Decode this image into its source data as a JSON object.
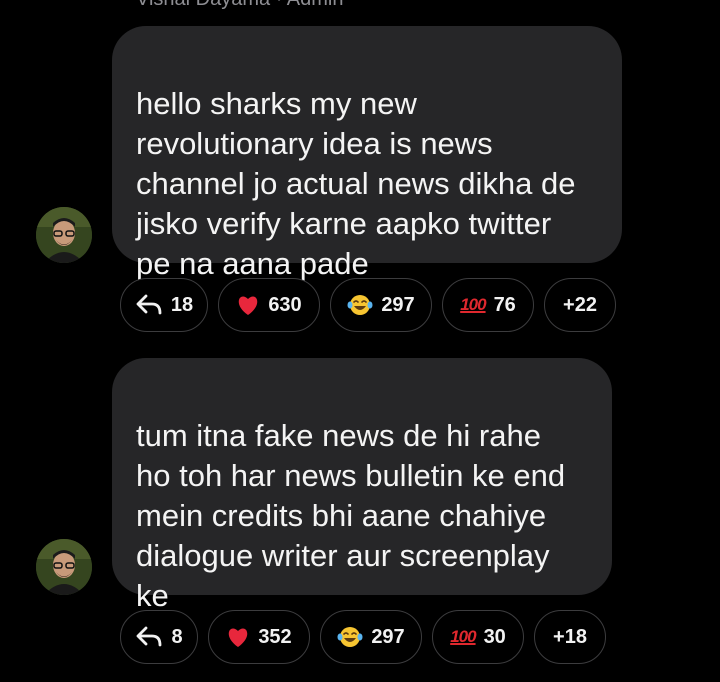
{
  "header": {
    "sender": "Vishal Dayama · Admin"
  },
  "messages": [
    {
      "text": "hello sharks my new\nrevolutionary idea is news\nchannel jo actual news dikha de\njisko verify karne aapko twitter\npe na aana pade",
      "reactions": {
        "reply": "18",
        "heart": "630",
        "laugh": "297",
        "hundred": "76",
        "more": "+22"
      }
    },
    {
      "text": "tum itna fake news de hi rahe\nho toh har news bulletin ke end\nmein credits bhi aane chahiye\ndialogue writer aur screenplay\nke",
      "reactions": {
        "reply": "8",
        "heart": "352",
        "laugh": "297",
        "hundred": "30",
        "more": "+18"
      }
    }
  ],
  "icons": {
    "reply": "reply-arrow-icon",
    "heart": "red-heart-icon",
    "laugh": "laughing-tears-icon",
    "hundred": "hundred-points-icon"
  },
  "colors": {
    "background": "#000000",
    "bubble": "#262628",
    "chip_border": "#3c3c3e",
    "heart": "#e8273c",
    "hundred": "#e0282e"
  }
}
